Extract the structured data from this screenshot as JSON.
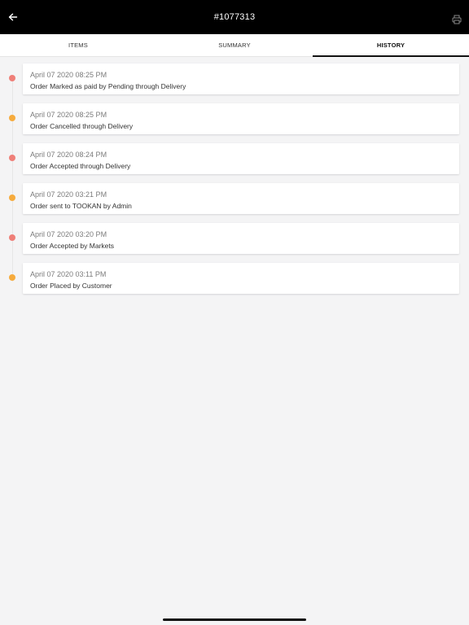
{
  "header": {
    "title": "#1077313",
    "back_icon": "arrow-left-icon",
    "print_icon": "printer-icon"
  },
  "tabs": [
    {
      "label": "ITEMS",
      "active": false
    },
    {
      "label": "SUMMARY",
      "active": false
    },
    {
      "label": "HISTORY",
      "active": true
    }
  ],
  "history": [
    {
      "timestamp": "April 07 2020 08:25 PM",
      "description": "Order Marked as paid by Pending through Delivery",
      "dot_color": "#ef7f78"
    },
    {
      "timestamp": "April 07 2020 08:25 PM",
      "description": "Order Cancelled through Delivery",
      "dot_color": "#f6ab3d"
    },
    {
      "timestamp": "April 07 2020 08:24 PM",
      "description": "Order Accepted through Delivery",
      "dot_color": "#ef7f78"
    },
    {
      "timestamp": "April 07 2020 03:21 PM",
      "description": "Order sent to TOOKAN by Admin",
      "dot_color": "#f6ab3d"
    },
    {
      "timestamp": "April 07 2020 03:20 PM",
      "description": "Order Accepted by Markets",
      "dot_color": "#ef7f78"
    },
    {
      "timestamp": "April 07 2020 03:11 PM",
      "description": "Order Placed by Customer",
      "dot_color": "#f6ab3d"
    }
  ]
}
